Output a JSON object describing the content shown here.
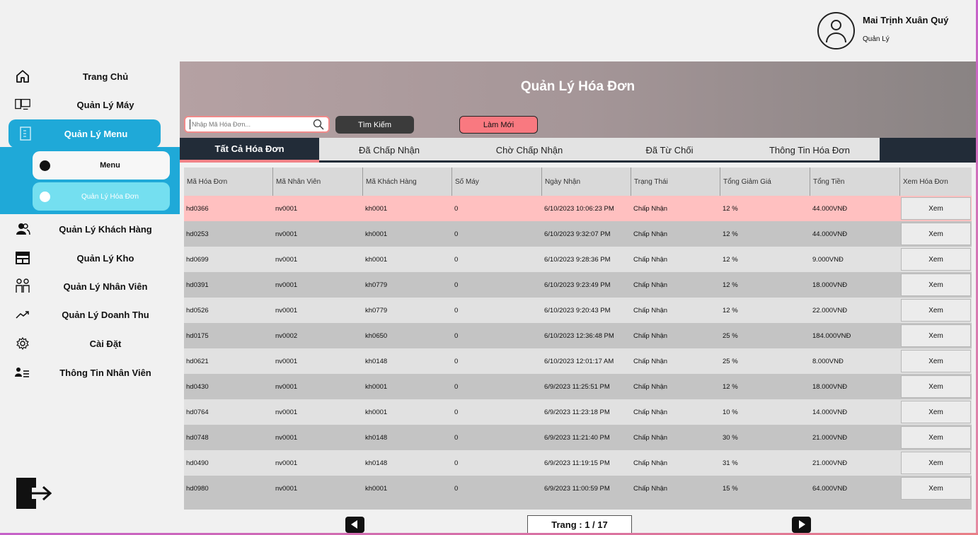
{
  "user": {
    "name": "Mai Trịnh Xuân Quý",
    "role": "Quản Lý"
  },
  "sidebar": {
    "items": [
      {
        "label": "Trang Chủ",
        "icon": "home-icon"
      },
      {
        "label": "Quản Lý Máy",
        "icon": "computer-icon"
      },
      {
        "label": "Quản Lý Menu",
        "icon": "menu-book-icon"
      },
      {
        "label": "Quản Lý Khách Hàng",
        "icon": "users-icon"
      },
      {
        "label": "Quản Lý Kho",
        "icon": "store-icon"
      },
      {
        "label": "Quản Lý Nhân Viên",
        "icon": "staff-icon"
      },
      {
        "label": "Quản Lý Doanh Thu",
        "icon": "trend-icon"
      },
      {
        "label": "Cài Đặt",
        "icon": "gear-icon"
      },
      {
        "label": "Thông Tin Nhân Viên",
        "icon": "profile-list-icon"
      }
    ],
    "submenu": [
      {
        "label": "Menu"
      },
      {
        "label": "Quản Lý Hóa Đơn"
      }
    ]
  },
  "main": {
    "title": "Quản Lý Hóa Đơn",
    "search": {
      "placeholder": "Nhập Mã Hóa Đơn...",
      "button": "Tìm Kiếm"
    },
    "refresh_button": "Làm Mới",
    "tabs": [
      {
        "label": "Tất Cả Hóa Đơn"
      },
      {
        "label": "Đã Chấp Nhận"
      },
      {
        "label": "Chờ Chấp Nhận"
      },
      {
        "label": "Đã Từ Chối"
      },
      {
        "label": "Thông Tin Hóa Đơn"
      }
    ],
    "table": {
      "columns": [
        "Mã Hóa Đơn",
        "Mã Nhân Viên",
        "Mã Khách Hàng",
        "Số Máy",
        "Ngày Nhận",
        "Trạng Thái",
        "Tổng Giảm Giá",
        "Tổng Tiền",
        "Xem Hóa Đơn"
      ],
      "view_label": "Xem",
      "rows": [
        [
          "hd0366",
          "nv0001",
          "kh0001",
          "0",
          "6/10/2023 10:06:23 PM",
          "Chấp Nhận",
          "12 %",
          "44.000VNĐ"
        ],
        [
          "hd0253",
          "nv0001",
          "kh0001",
          "0",
          "6/10/2023 9:32:07 PM",
          "Chấp Nhận",
          "12 %",
          "44.000VNĐ"
        ],
        [
          "hd0699",
          "nv0001",
          "kh0001",
          "0",
          "6/10/2023 9:28:36 PM",
          "Chấp Nhận",
          "12 %",
          "9.000VNĐ"
        ],
        [
          "hd0391",
          "nv0001",
          "kh0779",
          "0",
          "6/10/2023 9:23:49 PM",
          "Chấp Nhận",
          "12 %",
          "18.000VNĐ"
        ],
        [
          "hd0526",
          "nv0001",
          "kh0779",
          "0",
          "6/10/2023 9:20:43 PM",
          "Chấp Nhận",
          "12 %",
          "22.000VNĐ"
        ],
        [
          "hd0175",
          "nv0002",
          "kh0650",
          "0",
          "6/10/2023 12:36:48 PM",
          "Chấp Nhận",
          "25 %",
          "184.000VNĐ"
        ],
        [
          "hd0621",
          "nv0001",
          "kh0148",
          "0",
          "6/10/2023 12:01:17 AM",
          "Chấp Nhận",
          "25 %",
          "8.000VNĐ"
        ],
        [
          "hd0430",
          "nv0001",
          "kh0001",
          "0",
          "6/9/2023 11:25:51 PM",
          "Chấp Nhận",
          "12 %",
          "18.000VNĐ"
        ],
        [
          "hd0764",
          "nv0001",
          "kh0001",
          "0",
          "6/9/2023 11:23:18 PM",
          "Chấp Nhận",
          "10 %",
          "14.000VNĐ"
        ],
        [
          "hd0748",
          "nv0001",
          "kh0148",
          "0",
          "6/9/2023 11:21:40 PM",
          "Chấp Nhận",
          "30 %",
          "21.000VNĐ"
        ],
        [
          "hd0490",
          "nv0001",
          "kh0148",
          "0",
          "6/9/2023 11:19:15 PM",
          "Chấp Nhận",
          "31 %",
          "21.000VNĐ"
        ],
        [
          "hd0980",
          "nv0001",
          "kh0001",
          "0",
          "6/9/2023 11:00:59 PM",
          "Chấp Nhận",
          "15 %",
          "64.000VNĐ"
        ]
      ]
    },
    "pagination": {
      "label": "Trang : 1 / 17"
    }
  },
  "colors": {
    "accent": "#1fa9d8",
    "submenu_active": "#74dff0",
    "selected_row": "#ffc0c0",
    "refresh_button": "#f97980",
    "tab_bar": "#222c38"
  }
}
